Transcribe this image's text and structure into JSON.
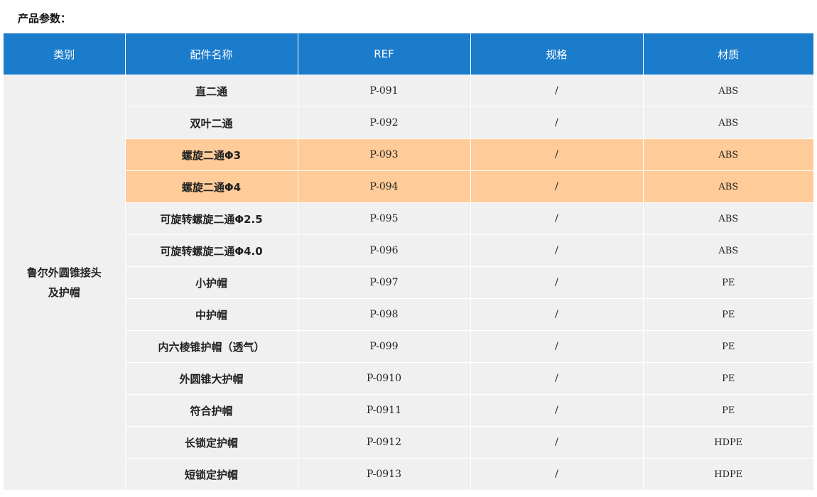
{
  "heading": "产品参数：",
  "table": {
    "headers": [
      "类别",
      "配件名称",
      "REF",
      "规格",
      "材质"
    ],
    "category_line1": "鲁尔外圆锥接头",
    "category_line2": "及护帽",
    "highlight_color": "#ffcc99",
    "header_color": "#1b7ccc",
    "row_color": "#f0f0f0",
    "rows": [
      {
        "name": "直二通",
        "ref": "P-091",
        "spec": "/",
        "material": "ABS"
      },
      {
        "name": "双叶二通",
        "ref": "P-092",
        "spec": "/",
        "material": "ABS"
      },
      {
        "name": "螺旋二通Φ3",
        "ref": "P-093",
        "spec": "/",
        "material": "ABS"
      },
      {
        "name": "螺旋二通Φ4",
        "ref": "P-094",
        "spec": "/",
        "material": "ABS"
      },
      {
        "name": "可旋转螺旋二通Φ2.5",
        "ref": "P-095",
        "spec": "/",
        "material": "ABS"
      },
      {
        "name": "可旋转螺旋二通Φ4.0",
        "ref": "P-096",
        "spec": "/",
        "material": "ABS"
      },
      {
        "name": "小护帽",
        "ref": "P-097",
        "spec": "/",
        "material": "PE"
      },
      {
        "name": "中护帽",
        "ref": "P-098",
        "spec": "/",
        "material": "PE"
      },
      {
        "name": "内六棱锥护帽（透气）",
        "ref": "P-099",
        "spec": "/",
        "material": "PE"
      },
      {
        "name": "外圆锥大护帽",
        "ref": "P-0910",
        "spec": "/",
        "material": "PE"
      },
      {
        "name": "符合护帽",
        "ref": "P-0911",
        "spec": "/",
        "material": "PE"
      },
      {
        "name": "长锁定护帽",
        "ref": "P-0912",
        "spec": "/",
        "material": "HDPE"
      },
      {
        "name": "短锁定护帽",
        "ref": "P-0913",
        "spec": "/",
        "material": "HDPE"
      }
    ]
  }
}
